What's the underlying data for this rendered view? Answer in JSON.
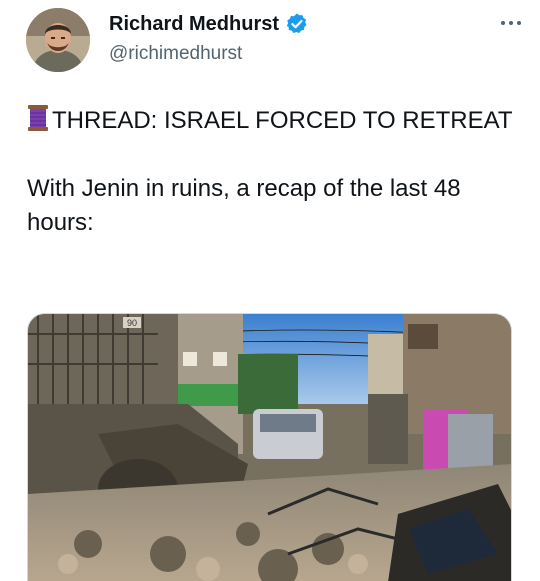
{
  "author": {
    "display_name": "Richard Medhurst",
    "handle": "@richimedhurst",
    "verified": true,
    "verified_icon": "verified-badge-icon",
    "verified_color": "#1d9bf0",
    "avatar_icon": "user-avatar"
  },
  "tweet": {
    "thread_icon": "spool-of-thread-icon",
    "line1": "THREAD: ISRAEL FORCED TO RETREAT",
    "line2": "With Jenin in ruins, a recap of the last 48 hours:",
    "more_icon": "more-options-icon"
  },
  "media": {
    "type": "photo",
    "sign_text": "90"
  }
}
